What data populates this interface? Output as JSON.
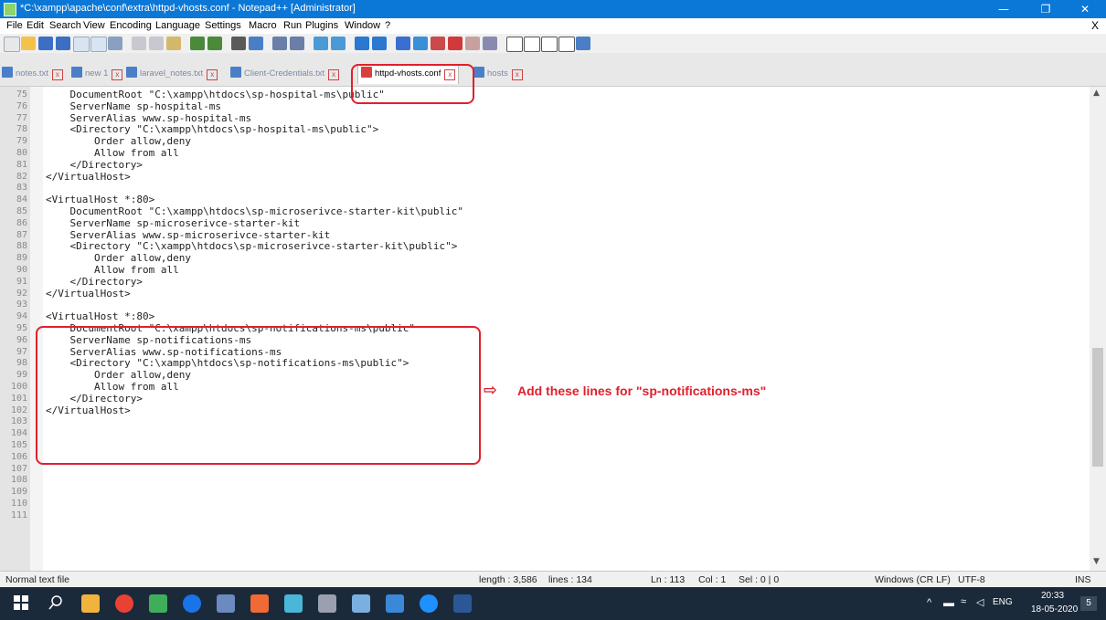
{
  "window": {
    "title": "*C:\\xampp\\apache\\conf\\extra\\httpd-vhosts.conf - Notepad++ [Administrator]",
    "minimize": "—",
    "maximize": "❐",
    "close": "✕"
  },
  "menu": {
    "items": [
      "File",
      "Edit",
      "Search",
      "View",
      "Encoding",
      "Language",
      "Settings",
      "Macro",
      "Run",
      "Plugins",
      "Window",
      "?"
    ],
    "close": "X"
  },
  "toolbar": {
    "icons": [
      "new-file-icon",
      "open-file-icon",
      "save-icon",
      "save-all-icon",
      "close-icon",
      "close-all-icon",
      "print-icon",
      "cut-icon",
      "copy-icon",
      "paste-icon",
      "undo-icon",
      "redo-icon",
      "find-icon",
      "replace-icon",
      "zoom-in-icon",
      "zoom-out-icon",
      "sync-v-icon",
      "sync-h-icon",
      "word-wrap-icon",
      "all-chars-icon",
      "indent-guide-icon",
      "udl-icon",
      "doc-map-icon",
      "function-list-icon",
      "folder-workspace-icon",
      "monitoring-icon",
      "record-macro-icon",
      "stop-macro-icon",
      "play-macro-icon",
      "run-macro-multiple-icon",
      "save-macro-icon"
    ]
  },
  "tabs": [
    {
      "label": "notes.txt",
      "active": false
    },
    {
      "label": "new 1",
      "active": false
    },
    {
      "label": "laravel_notes.txt",
      "active": false
    },
    {
      "label": "Client-Credentials.txt",
      "active": false
    },
    {
      "label": "httpd-vhosts.conf",
      "active": true
    },
    {
      "label": "hosts",
      "active": false
    }
  ],
  "editor": {
    "lines": [
      {
        "n": "75",
        "text": "    DocumentRoot \"C:\\xampp\\htdocs\\sp-hospital-ms\\public\""
      },
      {
        "n": "76",
        "text": "    ServerName sp-hospital-ms"
      },
      {
        "n": "77",
        "text": "    ServerAlias www.sp-hospital-ms"
      },
      {
        "n": "78",
        "text": "    <Directory \"C:\\xampp\\htdocs\\sp-hospital-ms\\public\">"
      },
      {
        "n": "79",
        "text": "        Order allow,deny"
      },
      {
        "n": "80",
        "text": "        Allow from all"
      },
      {
        "n": "81",
        "text": "    </Directory>"
      },
      {
        "n": "82",
        "text": "</VirtualHost>"
      },
      {
        "n": "83",
        "text": ""
      },
      {
        "n": "84",
        "text": "<VirtualHost *:80>"
      },
      {
        "n": "85",
        "text": "    DocumentRoot \"C:\\xampp\\htdocs\\sp-microserivce-starter-kit\\public\""
      },
      {
        "n": "86",
        "text": "    ServerName sp-microserivce-starter-kit"
      },
      {
        "n": "87",
        "text": "    ServerAlias www.sp-microserivce-starter-kit"
      },
      {
        "n": "88",
        "text": "    <Directory \"C:\\xampp\\htdocs\\sp-microserivce-starter-kit\\public\">"
      },
      {
        "n": "89",
        "text": "        Order allow,deny"
      },
      {
        "n": "90",
        "text": "        Allow from all"
      },
      {
        "n": "91",
        "text": "    </Directory>"
      },
      {
        "n": "92",
        "text": "</VirtualHost>"
      },
      {
        "n": "93",
        "text": ""
      },
      {
        "n": "94",
        "text": "<VirtualHost *:80>"
      },
      {
        "n": "95",
        "text": "    DocumentRoot \"C:\\xampp\\htdocs\\sp-notifications-ms\\public\""
      },
      {
        "n": "96",
        "text": "    ServerName sp-notifications-ms"
      },
      {
        "n": "97",
        "text": "    ServerAlias www.sp-notifications-ms"
      },
      {
        "n": "98",
        "text": "    <Directory \"C:\\xampp\\htdocs\\sp-notifications-ms\\public\">"
      },
      {
        "n": "99",
        "text": "        Order allow,deny"
      },
      {
        "n": "100",
        "text": "        Allow from all"
      },
      {
        "n": "101",
        "text": "    </Directory>"
      },
      {
        "n": "102",
        "text": "</VirtualHost>"
      },
      {
        "n": "103",
        "text": ""
      },
      {
        "n": "104",
        "text": ""
      },
      {
        "n": "105",
        "text": ""
      },
      {
        "n": "106",
        "text": ""
      },
      {
        "n": "107",
        "text": ""
      },
      {
        "n": "108",
        "text": ""
      },
      {
        "n": "109",
        "text": ""
      },
      {
        "n": "110",
        "text": ""
      },
      {
        "n": "111",
        "text": ""
      }
    ]
  },
  "annotation": {
    "arrow": "⇨",
    "text": "Add  these  lines for \"sp-notifications-ms\""
  },
  "status": {
    "file_type": "Normal text file",
    "length": "length : 3,586",
    "lines": "lines : 134",
    "ln": "Ln : 113",
    "col": "Col : 1",
    "sel": "Sel : 0 | 0",
    "eol": "Windows (CR LF)",
    "encoding": "UTF-8",
    "mode": "INS"
  },
  "taskbar": {
    "lang": "ENG",
    "time": "20:33",
    "date": "18-05-2020",
    "notifications": "5"
  }
}
